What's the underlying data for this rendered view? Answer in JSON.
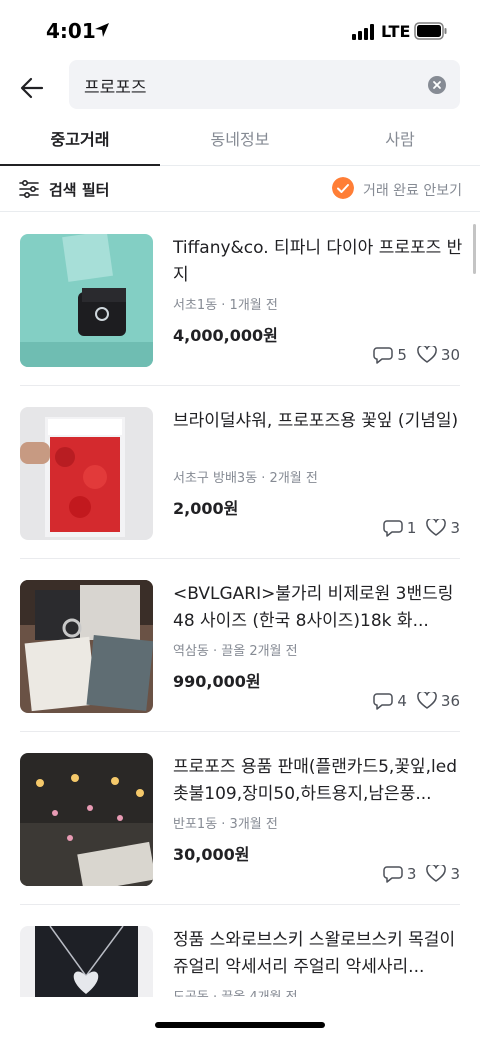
{
  "status_bar": {
    "time": "4:01",
    "network": "LTE"
  },
  "search": {
    "query": "프로포즈"
  },
  "tabs": [
    {
      "label": "중고거래",
      "active": true
    },
    {
      "label": "동네정보",
      "active": false
    },
    {
      "label": "사람",
      "active": false
    }
  ],
  "filter": {
    "label": "검색 필터",
    "hide_completed_label": "거래 완료 안보기",
    "hide_completed_checked": true
  },
  "items": [
    {
      "title": "Tiffany&co. 티파니 다이아 프로포즈 반지",
      "meta": "서초1동 · 1개월 전",
      "price": "4,000,000원",
      "chats": "5",
      "likes": "30"
    },
    {
      "title": "브라이덜샤워, 프로포즈용 꽃잎 (기념일)",
      "meta": "서초구 방배3동 · 2개월 전",
      "price": "2,000원",
      "chats": "1",
      "likes": "3"
    },
    {
      "title": "<BVLGARI>불가리 비제로원 3밴드링 48 사이즈 (한국 8사이즈)18k 화...",
      "meta": "역삼동 · 끌올 2개월 전",
      "price": "990,000원",
      "chats": "4",
      "likes": "36"
    },
    {
      "title": "프로포즈 용품 판매(플랜카드5,꽃잎,led촛불109,장미50,하트용지,남은풍...",
      "meta": "반포1동 · 3개월 전",
      "price": "30,000원",
      "chats": "3",
      "likes": "3"
    },
    {
      "title": "정품 스와로브스키 스왈로브스키 목걸이 쥬얼리 악세서리 주얼리 악세사리...",
      "meta": "도곡동 · 끌올 4개월 전"
    }
  ],
  "colors": {
    "accent": "#ff7e36",
    "text": "#212124",
    "muted": "#868b94"
  }
}
